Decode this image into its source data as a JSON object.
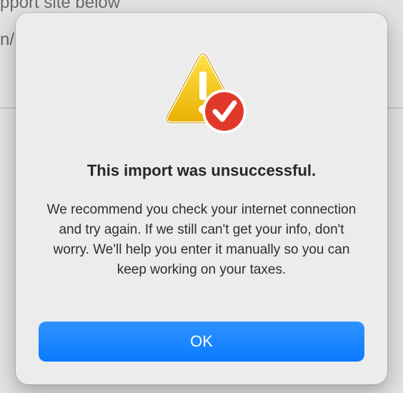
{
  "background": {
    "line1": "pport site below",
    "line2": "n/"
  },
  "dialog": {
    "title": "This import was unsuccessful.",
    "message": "We recommend you check your internet connection and try again. If we still can't get your info, don't worry. We'll help you enter it manually so you can keep working on your taxes.",
    "ok_label": "OK",
    "icon": "warning-triangle-with-checkmark-badge"
  },
  "colors": {
    "button": "#0a7aff",
    "warning": "#f5c400",
    "badge": "#e0392b"
  }
}
